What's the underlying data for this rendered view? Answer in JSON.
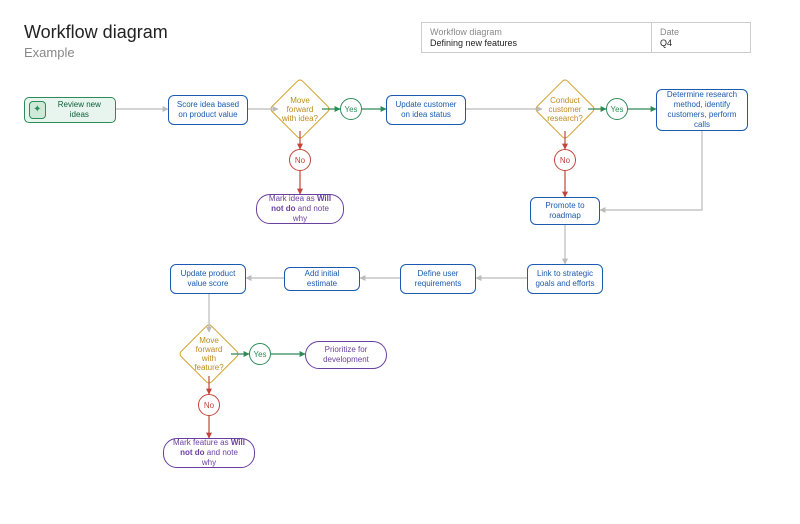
{
  "header": {
    "title": "Workflow diagram",
    "subtitle": "Example"
  },
  "info": {
    "label1": "Workflow diagram",
    "value1": "Defining new features",
    "label2": "Date",
    "value2": "Q4"
  },
  "nodes": {
    "start": "Review new ideas",
    "score": "Score idea based on product value",
    "dec1": "Move forward with idea?",
    "yes": "Yes",
    "no": "No",
    "update_status": "Update customer on idea status",
    "dec2": "Conduct customer research?",
    "research": "Determine research method, identify customers, perform calls",
    "willnot1_pre": "Mark idea as ",
    "willnot1_bold": "Will not do",
    "willnot1_post": " and note why",
    "promote": "Promote to roadmap",
    "link": "Link to strategic goals and efforts",
    "define": "Define user requirements",
    "estimate": "Add initial estimate",
    "update_score": "Update product value score",
    "dec3": "Move forward with feature?",
    "prioritize": "Prioritize for development",
    "willnot2_pre": "Mark feature as ",
    "willnot2_bold": "Will not do",
    "willnot2_post": " and note why"
  }
}
